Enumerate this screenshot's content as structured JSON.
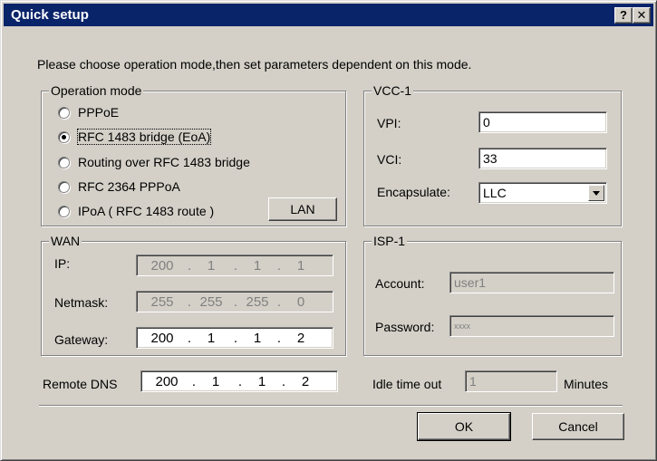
{
  "window": {
    "title": "Quick setup",
    "help_button": "?",
    "close_button": "✕"
  },
  "instruction": "Please choose operation mode,then set parameters dependent on  this mode.",
  "operation_mode": {
    "title": "Operation mode",
    "selected": "RFC 1483 bridge (EoA)",
    "options": [
      "PPPoE",
      "RFC 1483 bridge (EoA)",
      "Routing over RFC 1483 bridge",
      "RFC 2364 PPPoA",
      "IPoA ( RFC 1483 route )"
    ],
    "lan_button": "LAN"
  },
  "vcc": {
    "title": "VCC-1",
    "vpi_label": "VPI:",
    "vpi_value": "0",
    "vci_label": "VCI:",
    "vci_value": "33",
    "encapsulate_label": "Encapsulate:",
    "encapsulate_value": "LLC"
  },
  "wan": {
    "title": "WAN",
    "ip_label": "IP:",
    "ip": [
      "200",
      "1",
      "1",
      "1"
    ],
    "netmask_label": "Netmask:",
    "netmask": [
      "255",
      "255",
      "255",
      "0"
    ],
    "gateway_label": "Gateway:",
    "gateway": [
      "200",
      "1",
      "1",
      "2"
    ]
  },
  "isp": {
    "title": "ISP-1",
    "account_label": "Account:",
    "account_value": "user1",
    "password_label": "Password:",
    "password_value": "xxxx"
  },
  "remote_dns": {
    "label": "Remote DNS",
    "value": [
      "200",
      "1",
      "1",
      "2"
    ]
  },
  "idle": {
    "label": "Idle time out",
    "value": "1",
    "unit": "Minutes"
  },
  "buttons": {
    "ok": "OK",
    "cancel": "Cancel"
  }
}
